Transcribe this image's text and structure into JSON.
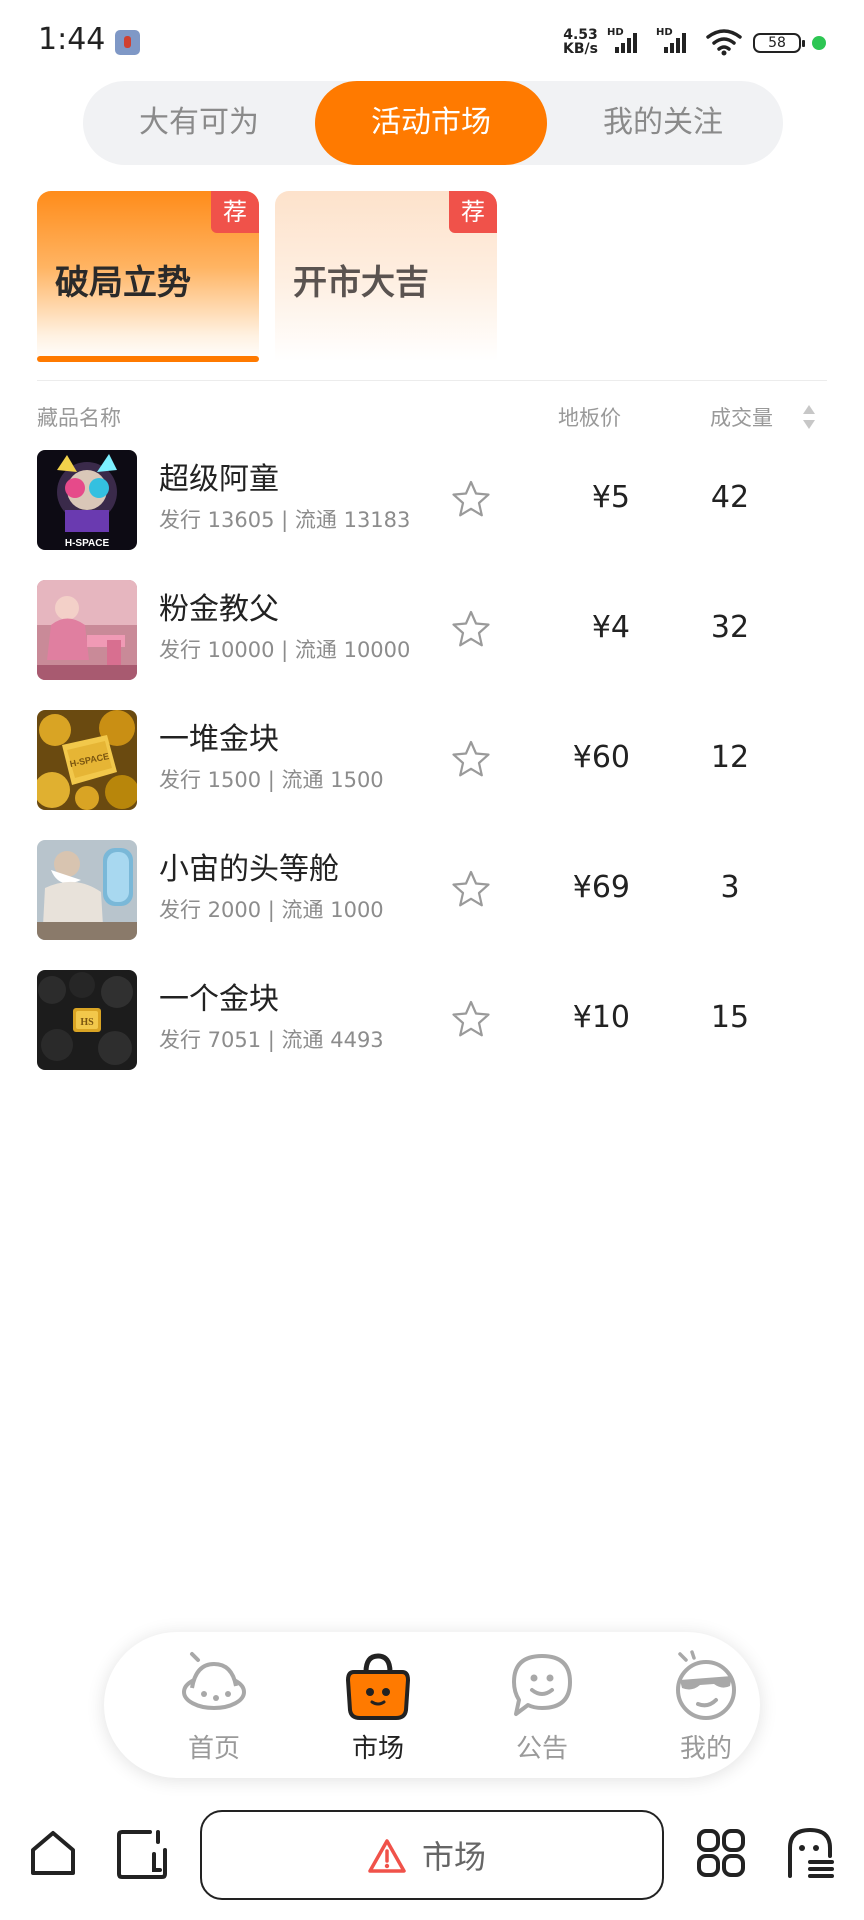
{
  "status_bar": {
    "time": "1:44",
    "net_speed_value": "4.53",
    "net_speed_unit": "KB/s",
    "hd_label_1": "HD",
    "hd_label_2": "HD",
    "battery": "58"
  },
  "top_tabs": [
    {
      "label": "大有可为",
      "active": false
    },
    {
      "label": "活动市场",
      "active": true
    },
    {
      "label": "我的关注",
      "active": false
    }
  ],
  "activity_cards": [
    {
      "title": "破局立势",
      "badge": "荐",
      "active": true
    },
    {
      "title": "开市大吉",
      "badge": "荐",
      "active": false
    }
  ],
  "table_header": {
    "name": "藏品名称",
    "floor_price": "地板价",
    "volume": "成交量"
  },
  "items": [
    {
      "name": "超级阿童",
      "meta": "发行 13605 | 流通 13183",
      "price": "¥5",
      "volume": "42",
      "thumb_text": "H-SPACE"
    },
    {
      "name": "粉金教父",
      "meta": "发行 10000 | 流通 10000",
      "price": "¥4",
      "volume": "32"
    },
    {
      "name": "一堆金块",
      "meta": "发行 1500 | 流通 1500",
      "price": "¥60",
      "volume": "12",
      "thumb_text": "H-SPACE"
    },
    {
      "name": "小宙的头等舱",
      "meta": "发行 2000 | 流通 1000",
      "price": "¥69",
      "volume": "3"
    },
    {
      "name": "一个金块",
      "meta": "发行 7051 | 流通 4493",
      "price": "¥10",
      "volume": "15",
      "thumb_text": "HS"
    }
  ],
  "bottom_nav": [
    {
      "label": "首页",
      "icon": "planet-icon",
      "active": false
    },
    {
      "label": "市场",
      "icon": "shopping-bag-icon",
      "active": true
    },
    {
      "label": "公告",
      "icon": "chat-bubble-icon",
      "active": false
    },
    {
      "label": "我的",
      "icon": "cool-face-icon",
      "active": false
    }
  ],
  "browser_bar": {
    "address_text": "市场",
    "warning_icon": "warning-triangle-icon",
    "accent": "#ff7a00",
    "warning_color": "#f0524a"
  }
}
